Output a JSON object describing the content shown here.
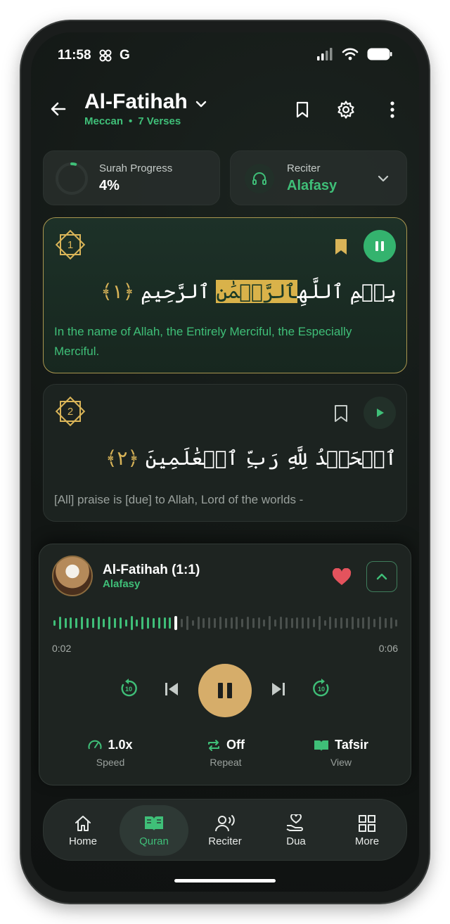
{
  "status": {
    "time": "11:58",
    "g_label": "G"
  },
  "header": {
    "title": "Al-Fatihah",
    "type": "Meccan",
    "separator": "•",
    "verses": "7 Verses"
  },
  "progress": {
    "label": "Surah Progress",
    "value": "4%",
    "fraction": 0.04
  },
  "reciter": {
    "label": "Reciter",
    "name": "Alafasy"
  },
  "verses": [
    {
      "number": "1",
      "arabic_start": "بِسۡمِ ٱللَّهِ",
      "arabic_highlight": "ٱلرَّحۡمَٰنِ",
      "arabic_end": "ٱلرَّحِيمِ",
      "ayah_marker": "﴿١﴾",
      "translation": "In the name of Allah, the Entirely Merciful, the Especially Merciful."
    },
    {
      "number": "2",
      "arabic": "ٱلۡحَمۡدُ لِلَّهِ رَبِّ ٱلۡعَٰلَمِينَ",
      "ayah_marker": "﴿٢﴾",
      "translation": "[All] praise is [due] to Allah, Lord of the worlds -"
    }
  ],
  "player": {
    "title": "Al-Fatihah (1:1)",
    "reciter": "Alafasy",
    "current_time": "0:02",
    "total_time": "0:06",
    "progress_fraction": 0.36,
    "skip_label": "10",
    "speed_value": "1.0x",
    "speed_label": "Speed",
    "repeat_value": "Off",
    "repeat_label": "Repeat",
    "tafsir_value": "Tafsir",
    "tafsir_label": "View"
  },
  "nav": [
    {
      "label": "Home",
      "icon": "home-icon"
    },
    {
      "label": "Quran",
      "icon": "book-icon"
    },
    {
      "label": "Reciter",
      "icon": "reciter-icon"
    },
    {
      "label": "Dua",
      "icon": "dua-icon"
    },
    {
      "label": "More",
      "icon": "grid-icon"
    }
  ],
  "colors": {
    "accent": "#3fbf78",
    "gold": "#d9b458",
    "play": "#d6ad6a",
    "heart": "#e4535d"
  }
}
